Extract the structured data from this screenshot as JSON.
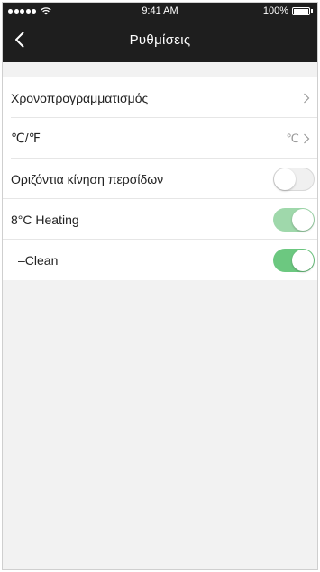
{
  "status_bar": {
    "time": "9:41 AM",
    "battery_percent": "100%",
    "battery_level": 1.0
  },
  "nav": {
    "title": "Ρυθμίσεις"
  },
  "settings": {
    "items": [
      {
        "label": "Χρονοπρογραμματισμός",
        "type": "link",
        "value": ""
      },
      {
        "label": "℃/℉",
        "type": "link",
        "value": "℃"
      },
      {
        "label": "Οριζόντια κίνηση περσίδων",
        "type": "toggle",
        "on": false
      },
      {
        "label": "8°C Heating",
        "type": "toggle",
        "on": true
      },
      {
        "label": "–Clean",
        "type": "toggle",
        "on": true
      }
    ]
  },
  "colors": {
    "header_bg": "#1e1e1e",
    "toggle_on": "#6cc880",
    "toggle_on_dim": "#9fd8ab",
    "page_bg": "#f2f2f2"
  }
}
